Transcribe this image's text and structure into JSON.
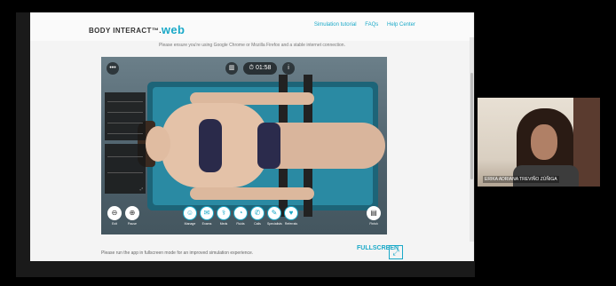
{
  "app": {
    "logo_text": "BODY INTERACT",
    "logo_tm": "™",
    "logo_dot": ".",
    "logo_web": "web",
    "nav": [
      "Simulation tutorial",
      "FAQs",
      "Help Center"
    ],
    "notice": "Please ensure you're using Google Chrome or Mozilla Firefox and a stable internet connection."
  },
  "simulation": {
    "timer": "01:58",
    "left_tools": [
      {
        "label": "Exit",
        "icon": "⊖"
      },
      {
        "label": "Pause",
        "icon": "⊕"
      }
    ],
    "tools": [
      {
        "label": "Manage",
        "icon": "☺"
      },
      {
        "label": "Exams",
        "icon": "✉"
      },
      {
        "label": "Meds",
        "icon": "⚕"
      },
      {
        "label": "Fluids",
        "icon": "◔"
      },
      {
        "label": "Calls",
        "icon": "✆"
      },
      {
        "label": "Specialists",
        "icon": "✎"
      },
      {
        "label": "Referrals",
        "icon": "♥"
      }
    ],
    "right_tool": {
      "label": "Finish",
      "icon": "▤"
    }
  },
  "footer": {
    "message": "Please run the app in fullscreen mode for an improved simulation experience.",
    "fullscreen_label": "FULLSCREEN",
    "fullscreen_icon": "⤢"
  },
  "participant": {
    "name": "ERIKA ADRIANA TREVIÑO ZÚÑIGA"
  },
  "colors": {
    "accent": "#1aa9c8",
    "bed": "#2a8aa3",
    "background": "#000000"
  }
}
